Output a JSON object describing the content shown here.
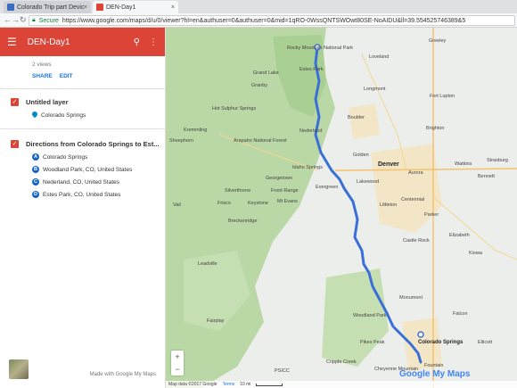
{
  "browser": {
    "tabs": [
      {
        "label": "Colorado Trip part Devic",
        "active": false
      },
      {
        "label": "DEN-Day1",
        "active": true
      }
    ],
    "secure_label": "Secure",
    "url": "https://www.google.com/maps/d/u/0/viewer?hl=en&authuser=0&authuser=0&mid=1qRO-0WssQNTSWOwt80SE-NoAIDU&ll=39.554525746389&5"
  },
  "panel": {
    "title": "DEN-Day1",
    "views": "2 views",
    "share": "SHARE",
    "edit": "EDIT",
    "layers": [
      {
        "title": "Untitled layer",
        "items": [
          {
            "icon": "pin",
            "label": "Colorado Springs"
          }
        ]
      },
      {
        "title": "Directions from Colorado Springs to Est...",
        "items": [
          {
            "badge": "A",
            "label": "Colorado Springs"
          },
          {
            "badge": "B",
            "label": "Woodland Park, CO, United States"
          },
          {
            "badge": "C",
            "label": "Nederland, CO, United States"
          },
          {
            "badge": "D",
            "label": "Estes Park, CO, United States"
          }
        ]
      }
    ],
    "footer": "Made with Google My Maps"
  },
  "map": {
    "labels": {
      "denver": "Denver",
      "boulder": "Boulder",
      "longmont": "Longmont",
      "greeley": "Greeley",
      "loveland": "Loveland",
      "estes": "Estes Park",
      "aurora": "Aurora",
      "parker": "Parker",
      "castle_rock": "Castle Rock",
      "colorado_springs": "Colorado Springs",
      "pikes_peak": "Pikes Peak",
      "nederland": "Nederland",
      "evergreen": "Evergreen",
      "breckenridge": "Breckenridge",
      "leadville": "Leadville",
      "hot_sulphur": "Hot Sulphur Springs",
      "arapaho": "Arapaho National Forest",
      "rmnp": "Rocky Mountain National Park",
      "front_range": "Front Range",
      "mt_evans": "Mt Evans",
      "keystone": "Keystone",
      "woodland_park": "Woodland Park",
      "cripple_creek": "Cripple Creek",
      "ellicott": "Ellicott",
      "kiowa": "Kiowa",
      "elizabeth": "Elizabeth",
      "bennett": "Bennett",
      "strasburg": "Strasburg",
      "watkins": "Watkins",
      "pscc": "PSICC",
      "fairplay": "Fairplay",
      "granby": "Granby",
      "grand_lake": "Grand Lake",
      "kremmling": "Kremmling",
      "silverthorne": "Silverthorne",
      "frisco": "Frisco",
      "vail": "Vail",
      "georgetown": "Georgetown",
      "idaho_springs": "Idaho Springs",
      "golden": "Golden",
      "lakewood": "Lakewood",
      "littleton": "Littleton",
      "centennial": "Centennial",
      "brighton": "Brighton",
      "fort_lupton": "Fort Lupton",
      "sheephorn": "Sheephorn",
      "monument": "Monument",
      "falcon": "Falcon",
      "fountain": "Fountain",
      "cheyenne_mountain": "Cheyenne Mountain"
    },
    "attribution": "Map data ©2017 Google",
    "terms": "Terms",
    "scale": "10 mi",
    "logo": "Google My Maps",
    "zoom_in": "+",
    "zoom_out": "−"
  },
  "colors": {
    "header": "#db4437",
    "route": "#3a6fd8",
    "forest": "#b9d8a6"
  }
}
